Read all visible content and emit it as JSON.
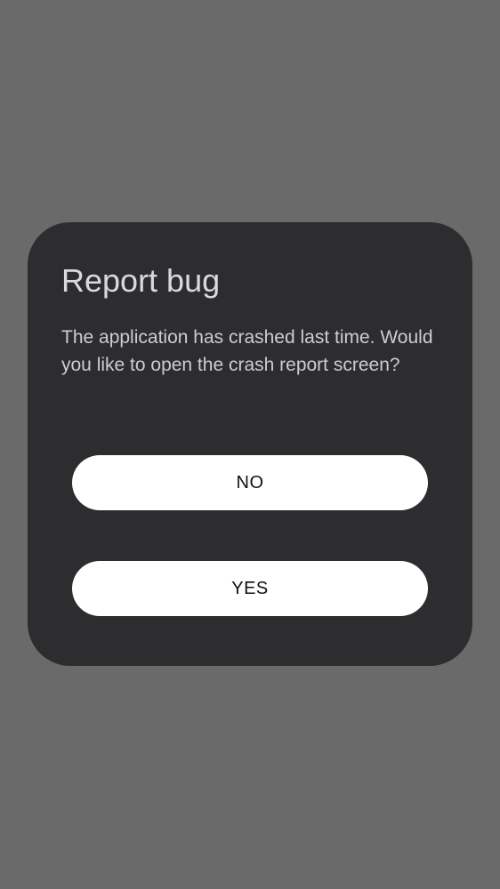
{
  "dialog": {
    "title": "Report bug",
    "message": "The application has crashed last time. Would you like to open the crash report screen?",
    "buttons": {
      "no_label": "NO",
      "yes_label": "YES"
    }
  },
  "colors": {
    "backdrop": "#6a6a6a",
    "dialog_background": "#2d2d30",
    "button_background": "#ffffff",
    "title_text": "#dcd9de"
  }
}
